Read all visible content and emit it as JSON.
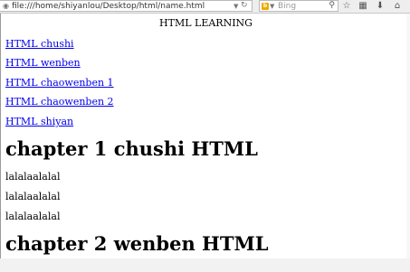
{
  "browser": {
    "url": "file:///home/shiyanlou/Desktop/html/name.html",
    "search_engine": "Bing",
    "icons": {
      "page": "page-info-icon",
      "dropdown": "chevron-down-icon",
      "reload": "reload-icon",
      "search": "magnifier-icon",
      "bookmark": "star-icon",
      "bookmarks_menu": "clipboard-icon",
      "downloads": "download-arrow-icon",
      "home": "home-icon"
    }
  },
  "page": {
    "title": "HTML LEARNING",
    "nav_links": [
      "HTML chushi",
      "HTML wenben",
      "HTML chaowenben 1",
      "HTML chaowenben 2",
      "HTML shiyan"
    ],
    "chapter1": {
      "heading": "chapter 1 chushi HTML",
      "paragraphs": [
        "lalalaalalal",
        "lalalaalalal",
        "lalalaalalal"
      ]
    },
    "chapter2": {
      "heading": "chapter 2 wenben HTML"
    }
  },
  "colors": {
    "link": "#0000ee",
    "toolbar": "#eeeeee",
    "engine_logo": "#f0a800"
  }
}
